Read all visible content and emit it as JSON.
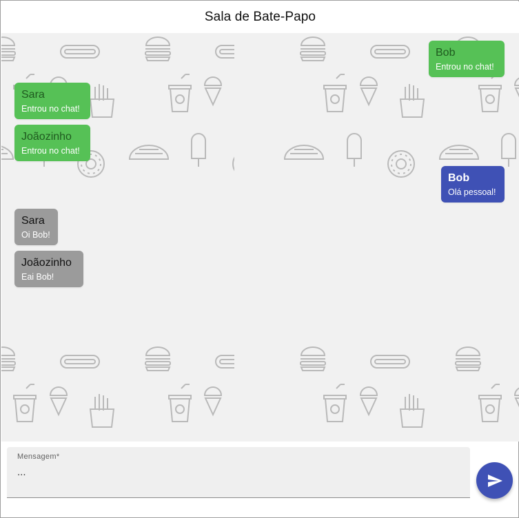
{
  "header": {
    "title": "Sala de Bate-Papo"
  },
  "messages": [
    {
      "kind": "system",
      "author": "Bob",
      "text": "Entrou no chat!"
    },
    {
      "kind": "system",
      "author": "Sara",
      "text": "Entrou no chat!"
    },
    {
      "kind": "system",
      "author": "Joãozinho",
      "text": "Entrou no chat!"
    },
    {
      "kind": "mine",
      "author": "Bob",
      "text": "Olá pessoal!"
    },
    {
      "kind": "other",
      "author": "Sara",
      "text": "Oi Bob!"
    },
    {
      "kind": "other",
      "author": "Joãozinho",
      "text": "Eai Bob!"
    }
  ],
  "composer": {
    "label": "Mensagem*",
    "value": "..."
  },
  "send_button": {
    "icon": "send-icon"
  },
  "colors": {
    "system_bubble": "#56c156",
    "mine_bubble": "#3f51b5",
    "other_bubble": "#9b9b9b",
    "chat_background": "#f1f1f1",
    "accent": "#3f51b5"
  },
  "background_pattern_icons": [
    "burger-icon",
    "hotdog-icon",
    "ice-cream-cone-icon",
    "soda-cup-icon",
    "fries-icon",
    "taco-icon",
    "popsicle-icon",
    "donut-icon"
  ]
}
